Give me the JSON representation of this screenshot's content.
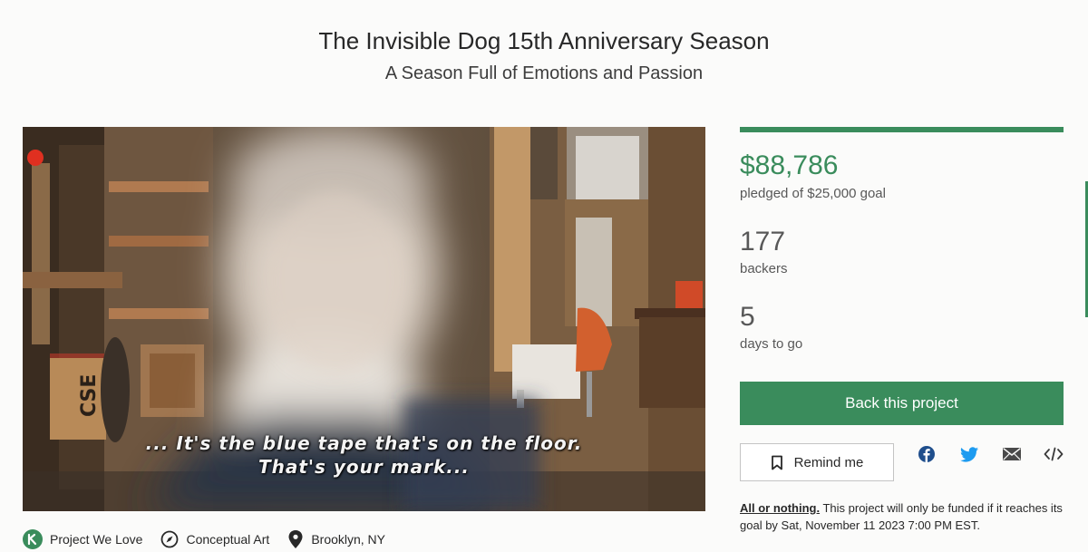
{
  "header": {
    "title": "The Invisible Dog 15th Anniversary Season",
    "subtitle": "A Season Full of Emotions and Passion"
  },
  "video": {
    "caption_line1": "... It's the blue tape that's on the floor.",
    "caption_line2": "That's your mark..."
  },
  "tags": [
    {
      "label": "Project We Love",
      "icon": "kickstarter-badge-icon"
    },
    {
      "label": "Conceptual Art",
      "icon": "compass-icon"
    },
    {
      "label": "Brooklyn, NY",
      "icon": "location-pin-icon"
    }
  ],
  "stats": {
    "progress_fraction": 1.0,
    "pledged_amount": "$88,786",
    "pledged_label": "pledged of $25,000 goal",
    "backers_count": "177",
    "backers_label": "backers",
    "days_count": "5",
    "days_label": "days to go"
  },
  "actions": {
    "back_label": "Back this project",
    "remind_label": "Remind me",
    "share_icons": [
      "facebook-icon",
      "twitter-icon",
      "email-icon",
      "embed-icon"
    ]
  },
  "funding_note": {
    "emphasis": "All or nothing.",
    "text": " This project will only be funded if it reaches its goal by Sat, November 11 2023 7:00 PM EST."
  },
  "colors": {
    "accent": "#3a8c5c",
    "background": "#fbfbfa",
    "text": "#282828"
  }
}
